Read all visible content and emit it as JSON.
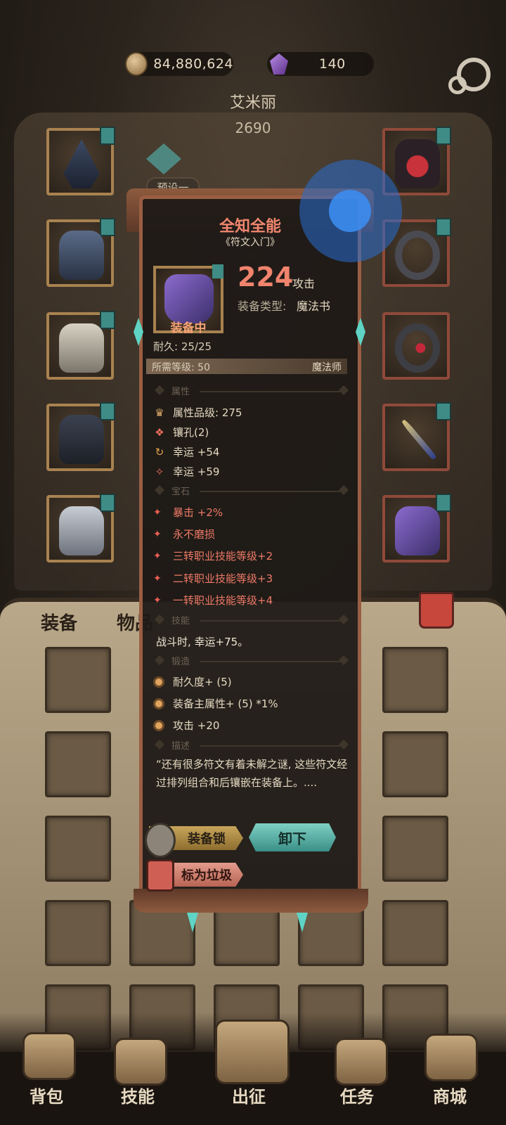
{
  "currency": {
    "gold": "84,880,624",
    "gems": "140"
  },
  "hero": {
    "name": "艾米丽",
    "power": "2690",
    "preset_label": "预设一"
  },
  "inventory_tabs": {
    "equipment": "装备",
    "items": "物品"
  },
  "item": {
    "name": "全知全能",
    "subtitle": "《符文入门》",
    "equipped_label": "装备中",
    "attack_value": "224",
    "attack_label": "攻击",
    "type_label": "装备类型:",
    "type_value": "魔法书",
    "durability": "耐久: 25/25",
    "required_level": "所需等级: 50",
    "class": "魔法师",
    "sections": {
      "attributes": "属性",
      "gems": "宝石",
      "skill": "技能",
      "forge": "锻造",
      "description": "描述"
    },
    "attributes": [
      "属性品级: 275",
      "镶孔(2)",
      "幸运 +54",
      "幸运 +59"
    ],
    "gems": [
      "暴击 +2%",
      "永不磨损",
      "三转职业技能等级+2",
      "二转职业技能等级+3",
      "一转职业技能等级+4"
    ],
    "skill_text": "战斗时, 幸运+75。",
    "forge": [
      "耐久度+ (5)",
      "装备主属性+ (5) *1%",
      "攻击 +20"
    ],
    "description": "“还有很多符文有着未解之谜, 这些符文经过排列组合和后镶嵌在装备上。....",
    "buttons": {
      "lock": "装备锁",
      "unequip": "卸下",
      "mark_junk": "标为垃圾"
    }
  },
  "bottom_nav": [
    "背包",
    "技能",
    "出征",
    "任务",
    "商城"
  ],
  "colors": {
    "accent_red": "#f0846d",
    "teal": "#5fd4c4",
    "panel_border": "#9a5e43"
  }
}
